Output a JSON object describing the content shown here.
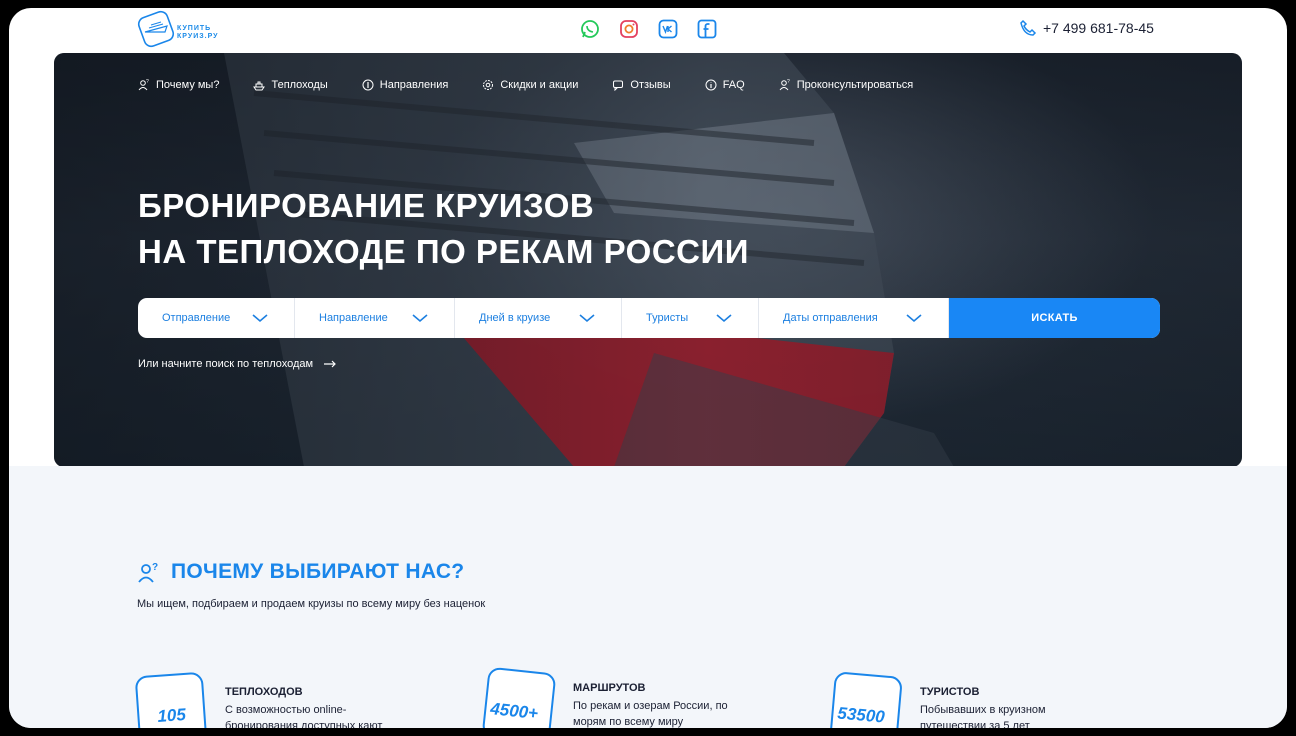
{
  "header": {
    "logo_text_1": "КУПИТЬ",
    "logo_text_2": "КРУИЗ.РУ",
    "phone": "+7 499 681-78-45",
    "socials": [
      "whatsapp-icon",
      "instagram-icon",
      "vk-icon",
      "facebook-icon"
    ]
  },
  "nav": {
    "items": [
      {
        "label": "Почему мы?",
        "icon": "person-question-icon"
      },
      {
        "label": "Теплоходы",
        "icon": "ship-icon"
      },
      {
        "label": "Направления",
        "icon": "compass-icon"
      },
      {
        "label": "Скидки и акции",
        "icon": "gear-icon"
      },
      {
        "label": "Отзывы",
        "icon": "chat-icon"
      },
      {
        "label": "FAQ",
        "icon": "info-icon"
      },
      {
        "label": "Проконсультироваться",
        "icon": "person-question-icon"
      }
    ]
  },
  "hero": {
    "title_line1": "БРОНИРОВАНИЕ КРУИЗОВ",
    "title_line2": "НА ТЕПЛОХОДЕ ПО РЕКАМ РОССИИ",
    "alt_link": "Или начните поиск по теплоходам"
  },
  "search": {
    "fields": [
      "Отправление",
      "Направление",
      "Дней в круизе",
      "Туристы",
      "Даты отправления"
    ],
    "button": "ИСКАТЬ"
  },
  "why": {
    "title": "ПОЧЕМУ ВЫБИРАЮТ НАС?",
    "subtitle": "Мы ищем, подбираем и продаем круизы по всему миру без наценок",
    "stats": [
      {
        "number": "105",
        "title": "ТЕПЛОХОДОВ",
        "desc": "С возможностью online-бронирования доступных кают"
      },
      {
        "number": "4500+",
        "title": "МАРШРУТОВ",
        "desc": "По рекам и озерам России, по морям по всему миру"
      },
      {
        "number": "53500",
        "title": "ТУРИСТОВ",
        "desc": "Побывавших в круизном путешествии за 5 лет"
      }
    ]
  },
  "colors": {
    "accent": "#1987f5",
    "text": "#1b2033",
    "section_bg": "#f3f6fa"
  }
}
